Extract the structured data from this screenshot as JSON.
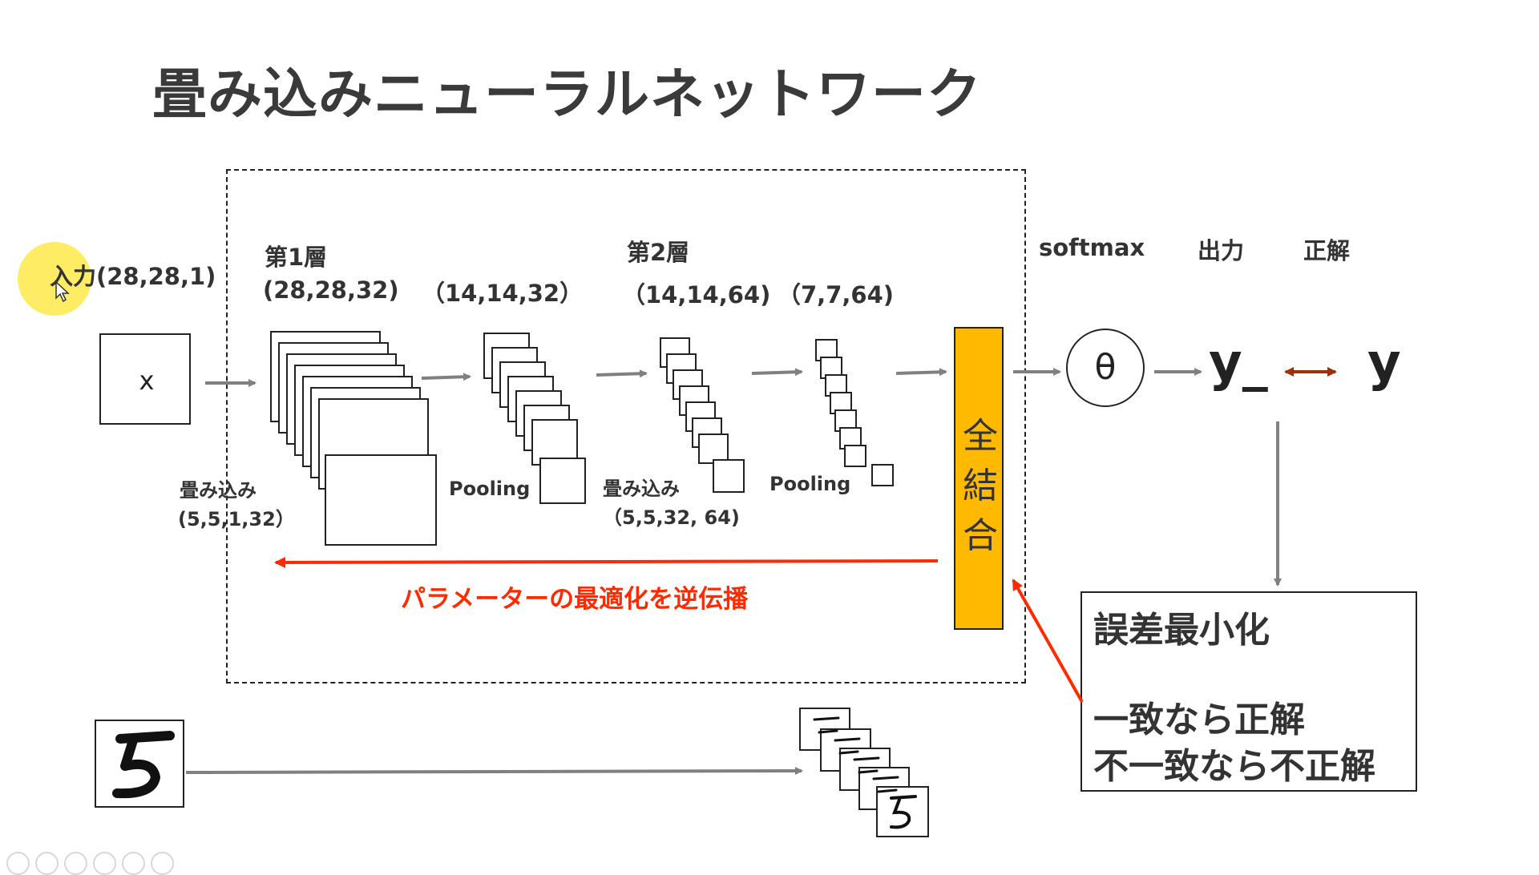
{
  "title": "畳み込みニューラルネットワーク",
  "input": {
    "label": "入力(28,28,1)",
    "symbol": "x"
  },
  "layer1": {
    "name": "第1層",
    "shape": "(28,28,32)",
    "conv_label": "畳み込み",
    "conv_kernel": "(5,5,1,32）",
    "pool_shape": "（14,14,32）",
    "pool_label": "Pooling"
  },
  "layer2": {
    "name": "第2層",
    "shape": "（14,14,64)",
    "conv_label": "畳み込み",
    "conv_kernel": "（5,5,32, 64)",
    "pool_shape": "（7,7,64)",
    "pool_label": "Pooling"
  },
  "fully_connected": {
    "chars": [
      "全",
      "結",
      "合"
    ]
  },
  "softmax": {
    "label": "softmax",
    "symbol": "θ"
  },
  "output": {
    "label": "出力",
    "symbol": "y_"
  },
  "answer": {
    "label": "正解",
    "symbol": "y"
  },
  "backprop": {
    "label": "パラメーターの最適化を逆伝播"
  },
  "error_box": {
    "line1": "誤差最小化",
    "line2": "一致なら正解",
    "line3": "不一致なら不正解"
  },
  "colors": {
    "fc": "#ffba00",
    "backprop": "#ff2a00",
    "bidirectional": "#a0300a",
    "arrow": "#808080",
    "cursor": "#ffe94a"
  }
}
